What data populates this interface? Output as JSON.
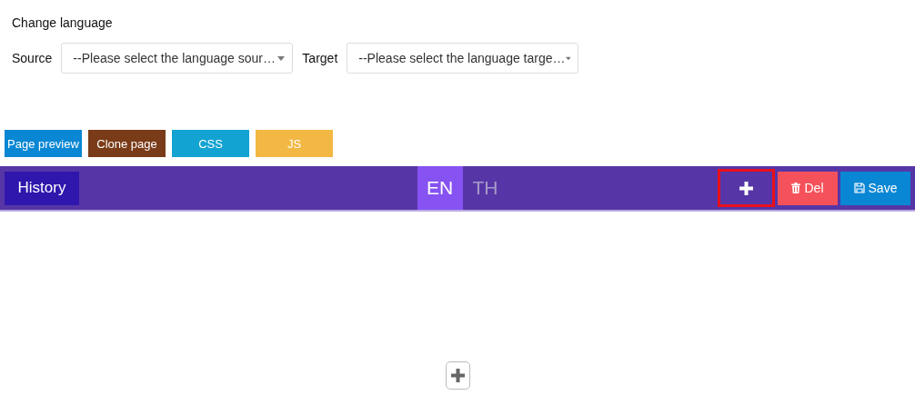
{
  "heading": "Change language",
  "source": {
    "label": "Source",
    "placeholder": "--Please select the language sour…"
  },
  "target": {
    "label": "Target",
    "placeholder": "--Please select the language targe…"
  },
  "actions": [
    {
      "label": "Page preview",
      "color": "#0a87d4"
    },
    {
      "label": "Clone page",
      "color": "#7a3b18"
    },
    {
      "label": "CSS",
      "color": "#12a3d2"
    },
    {
      "label": "JS",
      "color": "#f2b843"
    }
  ],
  "toolbar": {
    "history": "History",
    "languages": [
      {
        "label": "EN",
        "selected": true
      },
      {
        "label": "TH",
        "selected": false
      }
    ],
    "add": {
      "highlighted": true
    },
    "delete": "Del",
    "save": "Save"
  }
}
